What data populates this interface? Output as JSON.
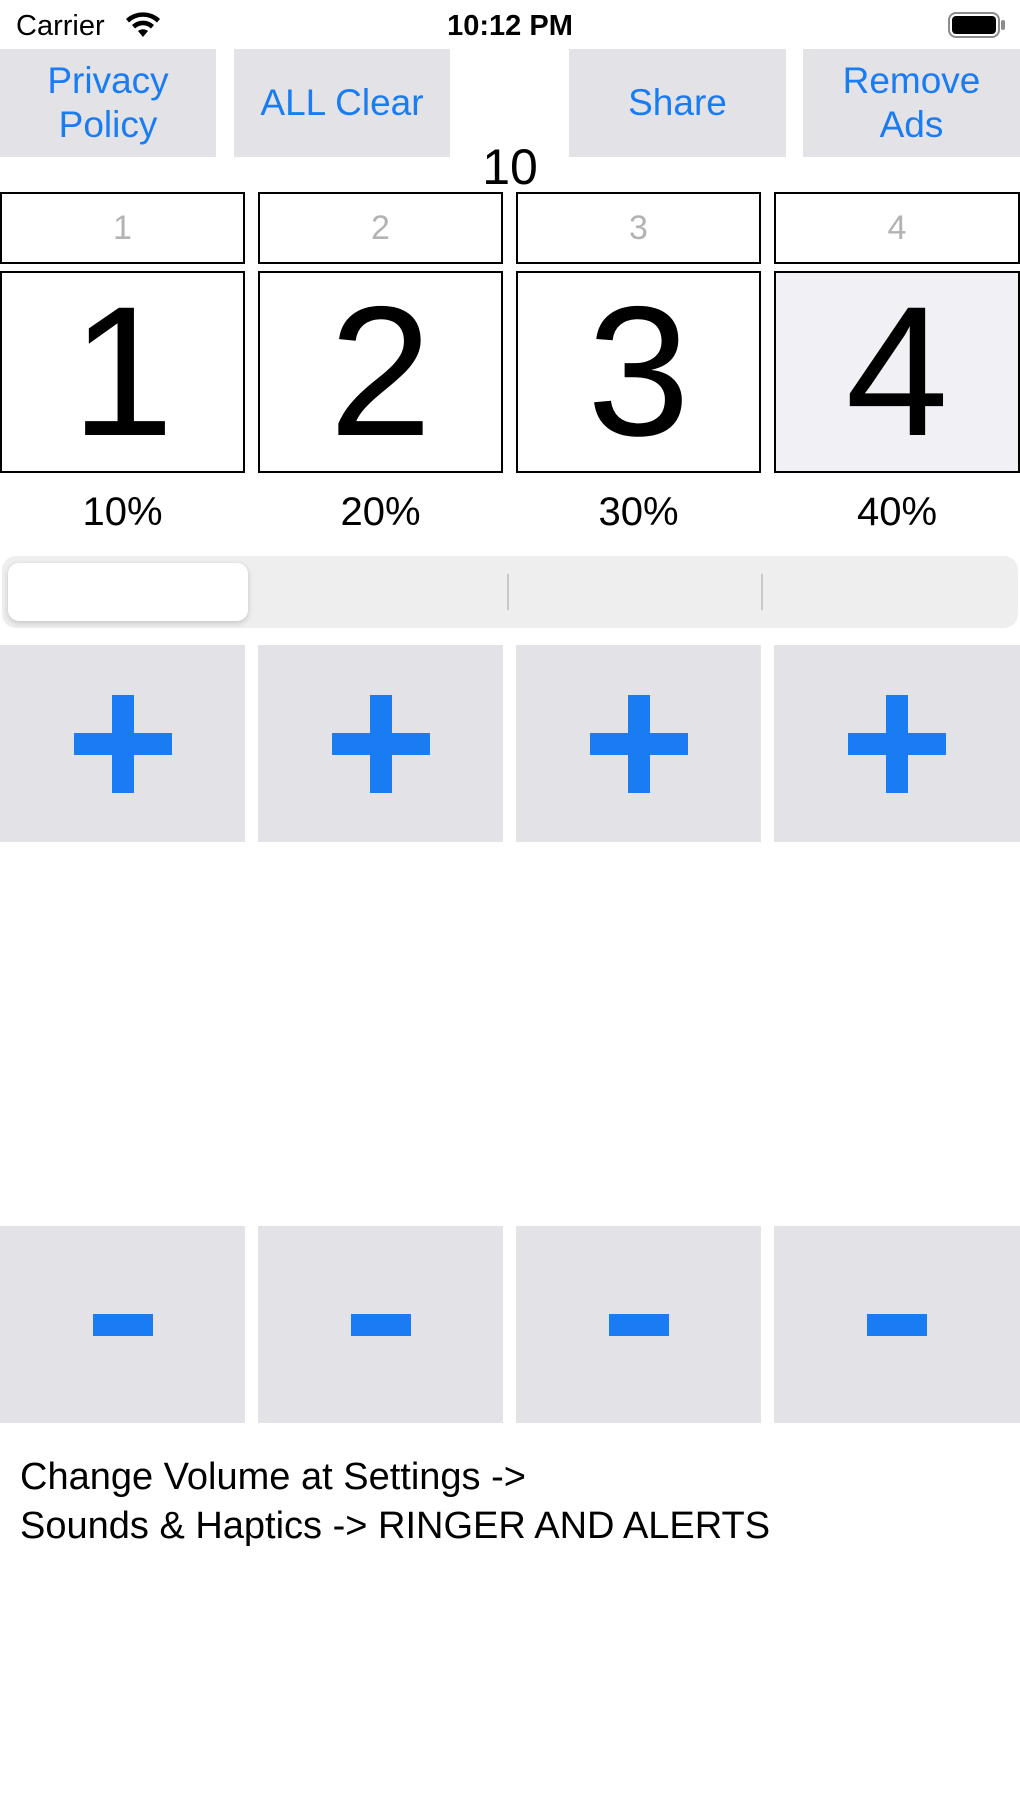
{
  "status_bar": {
    "carrier": "Carrier",
    "time": "10:12 PM"
  },
  "top_buttons": {
    "privacy_line1": "Privacy",
    "privacy_line2": "Policy",
    "all_clear": "ALL Clear",
    "share": "Share",
    "remove_ads_line1": "Remove",
    "remove_ads_line2": "Ads"
  },
  "total": "10",
  "columns": [
    {
      "label": "1",
      "value": "1",
      "percent": "10%",
      "selected": false
    },
    {
      "label": "2",
      "value": "2",
      "percent": "20%",
      "selected": false
    },
    {
      "label": "3",
      "value": "3",
      "percent": "30%",
      "selected": false
    },
    {
      "label": "4",
      "value": "4",
      "percent": "40%",
      "selected": true
    }
  ],
  "segmented": {
    "selected_index": 0,
    "segment_count": 4
  },
  "note": {
    "line1": "Change Volume at Settings ->",
    "line2": "Sounds & Haptics -> RINGER AND ALERTS"
  },
  "colors": {
    "accent": "#1a7cf2",
    "button_bg": "#e3e3e7",
    "selected_bg": "#f0f0f5"
  }
}
